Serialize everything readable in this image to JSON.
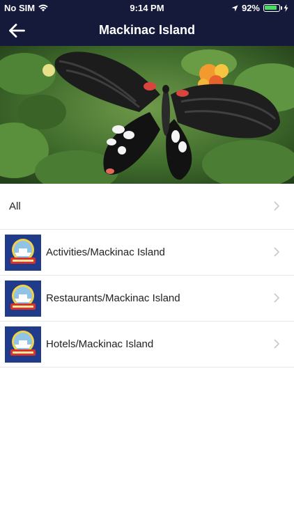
{
  "status_bar": {
    "carrier": "No SIM",
    "time": "9:14 PM",
    "battery_percent": "92%",
    "battery_level": 0.92
  },
  "navbar": {
    "title": "Mackinac Island",
    "back_icon": "arrow-left-icon"
  },
  "hero": {
    "image": "butterfly-photo"
  },
  "list": {
    "all_label": "All",
    "items": [
      {
        "label": "Activities/Mackinac Island",
        "icon": "shepler-logo"
      },
      {
        "label": "Restaurants/Mackinac Island",
        "icon": "shepler-logo"
      },
      {
        "label": "Hotels/Mackinac Island",
        "icon": "shepler-logo"
      }
    ]
  },
  "colors": {
    "navbar": "#15193a",
    "chevron": "#c8c8c8",
    "divider": "#e6e6e6"
  }
}
